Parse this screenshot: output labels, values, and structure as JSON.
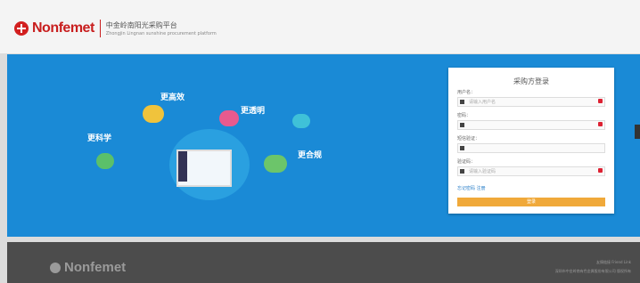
{
  "header": {
    "brand": "Nonfemet",
    "subtitle_cn": "中金岭南阳光采购平台",
    "subtitle_en": "Zhongjin Lingnan sunshine procurement platform"
  },
  "banner": {
    "tags": [
      "更科学",
      "更高效",
      "更透明",
      "更合规"
    ]
  },
  "login": {
    "title": "采购方登录",
    "fields": [
      {
        "label": "用户名：",
        "placeholder": "请输入用户名"
      },
      {
        "label": "密码：",
        "placeholder": ""
      },
      {
        "label": "短信验证：",
        "placeholder": ""
      },
      {
        "label": "验证码：",
        "placeholder": "请输入验证码"
      }
    ],
    "link": "忘记密码 注册",
    "button": "登录"
  },
  "footer": {
    "brand": "Nonfemet",
    "line1": "友情链接  Friend Link",
    "line2": "深圳市中金岭南有色金属股份有限公司  版权所有"
  },
  "colors": {
    "brand_red": "#c81e1e",
    "banner_blue": "#1a8ad6",
    "button_orange": "#f0a93a",
    "footer_grey": "#4c4c4c"
  }
}
